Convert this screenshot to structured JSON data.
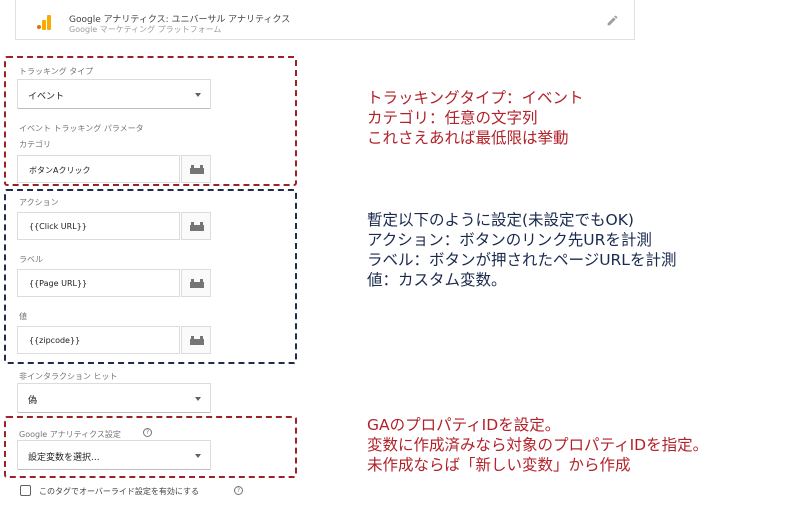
{
  "tag": {
    "title": "Google アナリティクス: ユニバーサル アナリティクス",
    "subtitle": "Google マーケティング プラットフォーム",
    "logo_icon": "analytics-bars-icon",
    "edit_icon": "pencil-icon"
  },
  "tracking": {
    "type_label": "トラッキング タイプ",
    "type_value": "イベント",
    "params_heading": "イベント トラッキング パラメータ",
    "category_label": "カテゴリ",
    "category_value": "ボタンAクリック",
    "action_label": "アクション",
    "action_value": "{{Click URL}}",
    "label_label": "ラベル",
    "label_value": "{{Page URL}}",
    "value_label": "値",
    "value_value": "{{zipcode}}",
    "noninteraction_label": "非インタラクション ヒット",
    "noninteraction_value": "偽",
    "settings_label": "Google アナリティクス設定",
    "settings_value": "設定変数を選択...",
    "override_label": "このタグでオーバーライド設定を有効にする",
    "variable_icon": "lego-brick-icon"
  },
  "annotations": {
    "red1": [
      "トラッキングタイプ：イベント",
      "カテゴリ：任意の文字列",
      "これさえあれば最低限は挙動"
    ],
    "navy": [
      "暫定以下のように設定(未設定でもOK)",
      "アクション：ボタンのリンク先URを計測",
      "ラベル：ボタンが押されたページURLを計測",
      "値：カスタム変数。"
    ],
    "red2": [
      "GAのプロパティIDを設定。",
      "変数に作成済みなら対象のプロパティIDを指定。",
      "未作成ならば「新しい変数」から作成"
    ]
  },
  "colors": {
    "red": "#b2222a",
    "navy": "#1a2a4d",
    "analytics_orange": "#f9ab00",
    "analytics_dark": "#e37400"
  }
}
